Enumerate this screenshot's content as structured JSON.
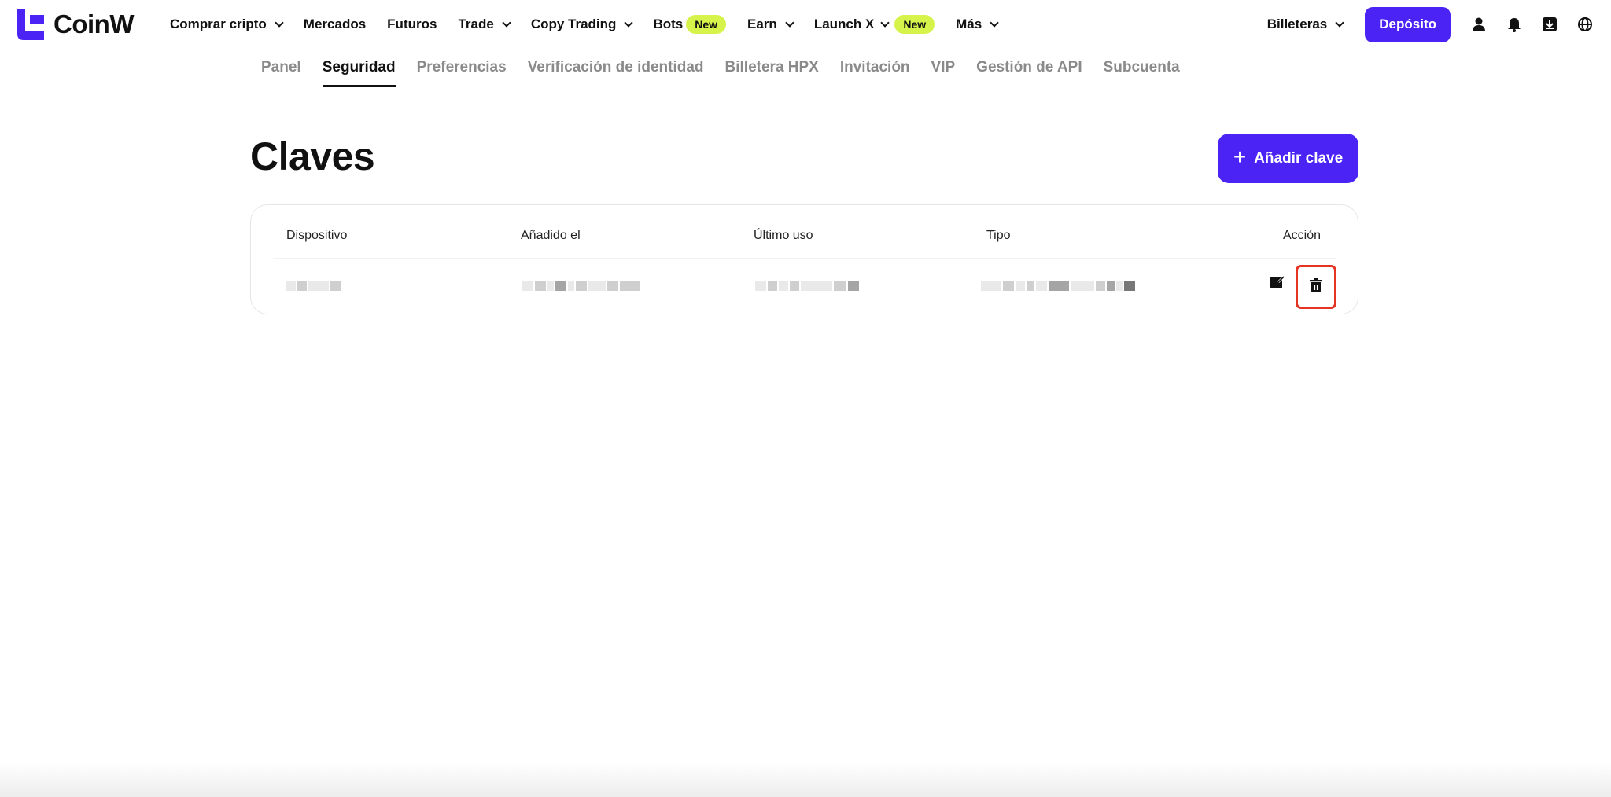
{
  "brand": {
    "name": "CoinW",
    "accent": "#4b24f5",
    "badge_color": "#d6f34b"
  },
  "nav": {
    "items": [
      {
        "label": "Comprar cripto",
        "dropdown": true
      },
      {
        "label": "Mercados",
        "dropdown": false
      },
      {
        "label": "Futuros",
        "dropdown": false
      },
      {
        "label": "Trade",
        "dropdown": true
      },
      {
        "label": "Copy Trading",
        "dropdown": true
      },
      {
        "label": "Bots",
        "badge": "New"
      },
      {
        "label": "Earn",
        "dropdown": true
      },
      {
        "label": "Launch X",
        "dropdown": true,
        "badge": "New"
      },
      {
        "label": "Más",
        "dropdown": true
      }
    ],
    "wallets_label": "Billeteras",
    "deposit_label": "Depósito",
    "icons": [
      "user-icon",
      "bell-icon",
      "download-icon",
      "globe-icon"
    ]
  },
  "subtabs": {
    "items": [
      "Panel",
      "Seguridad",
      "Preferencias",
      "Verificación de identidad",
      "Billetera HPX",
      "Invitación",
      "VIP",
      "Gestión de API",
      "Subcuenta"
    ],
    "active": "Seguridad"
  },
  "page": {
    "title": "Claves",
    "add_button_label": "Añadir clave"
  },
  "table": {
    "headers": [
      "Dispositivo",
      "Añadido el",
      "Último uso",
      "Tipo",
      "Acción"
    ],
    "rows": [
      {
        "cells_redacted": true,
        "actions": [
          "edit-icon",
          "trash-icon"
        ]
      }
    ],
    "highlight_color": "#e53424"
  }
}
